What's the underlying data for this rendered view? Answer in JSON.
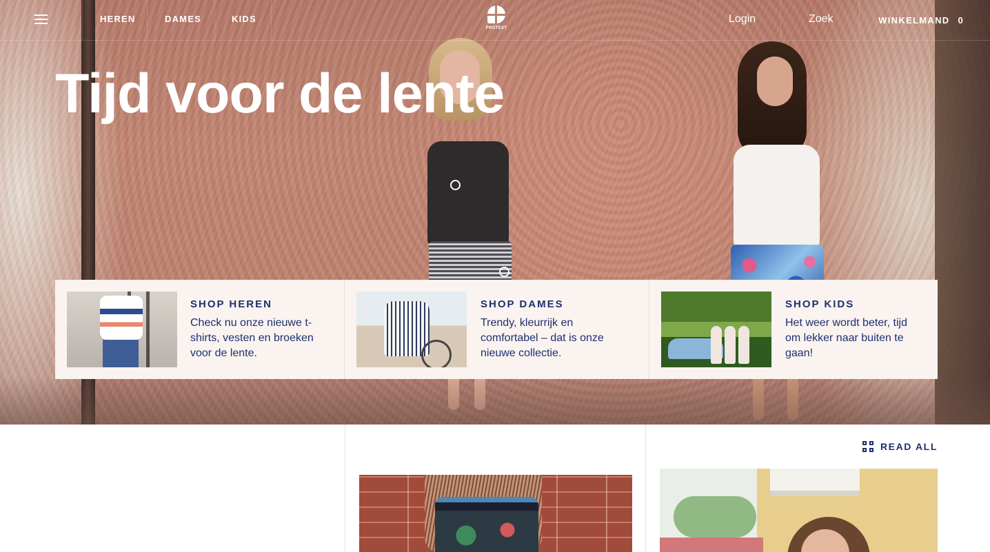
{
  "header": {
    "menu_icon": "hamburger-menu-icon",
    "nav": [
      {
        "label": "HEREN"
      },
      {
        "label": "DAMES"
      },
      {
        "label": "KIDS"
      }
    ],
    "logo_text": "PROTEST",
    "login_label": "Login",
    "search_label": "Zoek",
    "cart_label": "WINKELMAND",
    "cart_count": "0"
  },
  "hero": {
    "title": "Tijd voor de lente"
  },
  "shop_cards": [
    {
      "title": "SHOP HEREN",
      "description": "Check nu onze nieuwe t-shirts, vesten en broeken voor de lente."
    },
    {
      "title": "SHOP DAMES",
      "description": "Trendy, kleurrijk en comfortabel – dat is onze nieuwe collectie."
    },
    {
      "title": "SHOP KIDS",
      "description": "Het weer wordt beter, tijd om lekker naar buiten te gaan!"
    }
  ],
  "lower": {
    "read_all_label": "READ ALL",
    "read_all_icon": "grid-icon"
  },
  "colors": {
    "brand_navy": "#1d2f6f",
    "card_background": "#faf3f0",
    "header_text": "#ffffff"
  }
}
